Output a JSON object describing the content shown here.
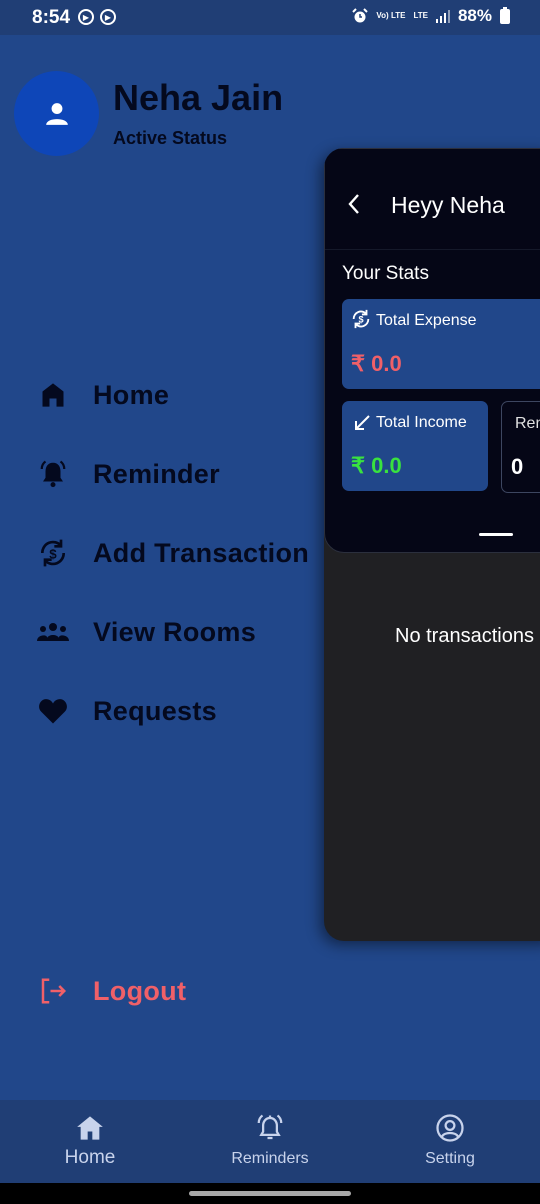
{
  "status_bar": {
    "time": "8:54",
    "battery": "88%",
    "network_top": "Vo) LTE",
    "network_bottom": "LTE"
  },
  "profile": {
    "name": "Neha Jain",
    "status": "Active Status"
  },
  "menu": {
    "items": [
      {
        "label": "Home",
        "icon": "home-icon"
      },
      {
        "label": "Reminder",
        "icon": "bell-icon"
      },
      {
        "label": "Add Transaction",
        "icon": "exchange-icon"
      },
      {
        "label": "View Rooms",
        "icon": "group-icon"
      },
      {
        "label": "Requests",
        "icon": "heart-icon"
      }
    ],
    "logout": {
      "label": "Logout",
      "icon": "logout-icon"
    }
  },
  "main": {
    "title": "Heyy Neha",
    "stats_heading": "Your Stats",
    "total_expense": {
      "label": "Total Expense",
      "value": "₹ 0.0"
    },
    "total_income": {
      "label": "Total Income",
      "value": "₹ 0.0"
    },
    "reminders_card": {
      "label": "Rem",
      "value": "0"
    },
    "empty_message": "No transactions "
  },
  "bottom_nav": [
    {
      "label": "Home",
      "icon": "home-icon"
    },
    {
      "label": "Reminders",
      "icon": "alarm-icon"
    },
    {
      "label": "Setting",
      "icon": "account-circle-icon"
    }
  ],
  "colors": {
    "drawer_bg": "#21478a",
    "expense": "#f06068",
    "income": "#39e23f",
    "logout": "#f06068"
  }
}
